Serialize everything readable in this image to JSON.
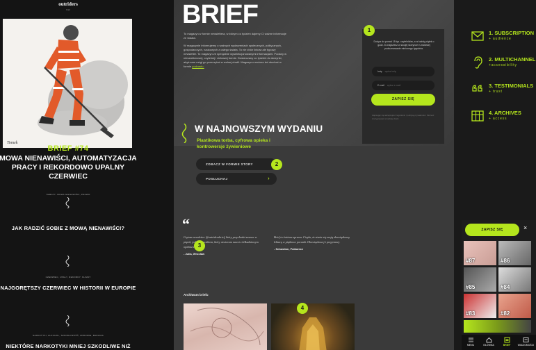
{
  "left_preview": {
    "brand": "outriders",
    "brand_sub": "brief",
    "hero_signature": "Tomek",
    "issue_tag": "BRIEF #74",
    "issue_title": "MOWA NIENAWIŚCI, AUTOMATYZACJA PRACY I REKORDOWO UPALNY CZERWIEC",
    "issue_small": "7 linii",
    "articles": [
      {
        "meta": "TEMATY: MOWA NIENAWIŚCI, PRAWO",
        "title": "JAK RADZIĆ SOBIE Z MOWĄ NIENAWIŚCI?"
      },
      {
        "meta": "CZERWIEC, UPAŁY, REKORDY, KLIMAT",
        "title": "NAJGORĘTSZY CZERWIEC W HISTORII W EUROPIE"
      },
      {
        "meta": "NARKOTYKI, ALKOHOL, SZKODLIWOŚĆ, ZDROWIE, BADANIA",
        "title": "NIEKTÓRE NARKOTYKI MNIEJ SZKODLIWE NIŻ ALKOHOL"
      }
    ]
  },
  "center": {
    "title": "BRIEF",
    "intro_paragraphs": [
      "To magazyn w formie newslettera, w którym co tydzień dajemy Ci ważne informacje ze świata.",
      "W magazynie informujemy o ważnych wydarzeniach społecznych, politycznych, gospodarczych, naukowych z całego świata. To nie zbiór linków ale typowy newsletter. To magazyn ze specjalnie wyselekcjonowanymi informacjami. Podany w nieszablonowej, czytelnej i ciekawej formie. Dostarczany co tydzień do skrzynki, abyś sam mógł go przeczytać w wolnej chwili. Magazynu możesz też słuchać w formie"
    ],
    "intro_link": "podcastu.",
    "signup": {
      "text": "Dołącz do ponad 15 tys. czytelników, a w każdy piątek o godz. 8 znajdziesz w swojej skrzynce e-mailowej podsumowanie minionego tygodnia.",
      "name_label": "Imię",
      "name_placeholder": "wpisz imię",
      "email_label": "E-mail",
      "email_placeholder": "wpisz e-mail",
      "button": "ZAPISZ SIĘ",
      "footer": "Zapisując się akceptujesz regulamin i politykę prywatności. Możesz zrezygnować w każdej chwili."
    },
    "latest": {
      "heading": "W NAJNOWSZYM WYDANIU",
      "subtitle": "Plastikowa torba, cyfrowa opieka i kontrowersje żywieniowe",
      "btn_story": "ZOBACZ W FORMIE STORY",
      "btn_listen": "POSŁUCHAJ"
    },
    "quotes": [
      {
        "text": "Czytam newsletter @outridersbrief, który przychodzi zawsze w piątek, jednym naciskiem, który otwieram nawet z kilkudniowym opóźnieniem :)",
        "author": "- Julia, Wrocław"
      },
      {
        "text": "Brief to świetna sprawa. Ciepło, że stanie się moją obowiązkową lekturą w piątkowe poranki. Obowiązkowej i przyjemnej.",
        "author": "- Sebastian, Pabianice"
      }
    ],
    "archive_label": "Archiwum briefu",
    "badges": [
      "1",
      "2",
      "3",
      "4"
    ]
  },
  "features": [
    {
      "icon": "envelope-icon",
      "title": "1. SUBSCRIPTION",
      "sub": "+ audience"
    },
    {
      "icon": "ear-icon",
      "title": "2. MULTICHANNEL",
      "sub": "+accessibility"
    },
    {
      "icon": "quote-icon",
      "title": "3. TESTIMONIALS",
      "sub": "+ trust"
    },
    {
      "icon": "archive-icon",
      "title": "4. ARCHIVES",
      "sub": "+ access"
    }
  ],
  "mobile": {
    "button": "ZAPISZ SIĘ",
    "close": "×",
    "tiles": [
      "#87",
      "#86",
      "#85",
      "#84",
      "#83",
      "#82"
    ],
    "nav": [
      "MENU",
      "GŁÓWNA",
      "BRIEF",
      "WIADOMOŚCI"
    ]
  },
  "colors": {
    "accent": "#b5e61d",
    "dark": "#141414",
    "panel": "#3a3a3a"
  }
}
